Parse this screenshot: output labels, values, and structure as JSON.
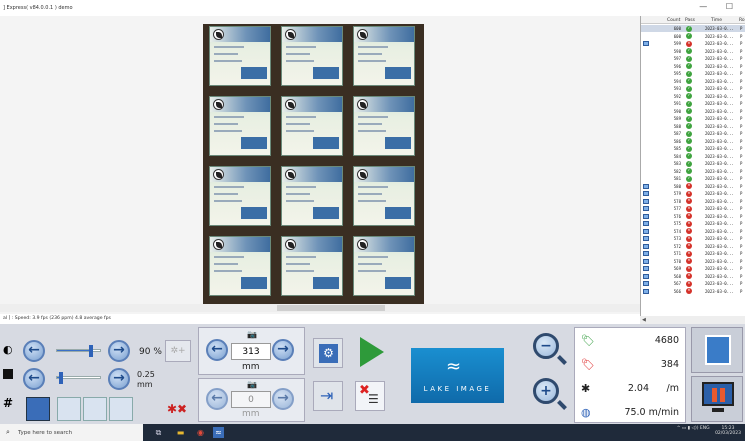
{
  "window": {
    "title": "] Express( v84.0.0.1 ) demo",
    "controls": "— ☐"
  },
  "status": {
    "speed_text": "al ] : Speed: 3.9 fps (236 ppm) 4.8 average fps"
  },
  "table": {
    "headers": {
      "count": "Count",
      "pass": "Pass",
      "time": "Time",
      "more": "Ro"
    },
    "time_text": "2023-03-0...",
    "more_text": "P",
    "rows": [
      {
        "count": "600",
        "pass": true,
        "icon": false,
        "selected": true
      },
      {
        "count": "600",
        "pass": true,
        "icon": false
      },
      {
        "count": "599",
        "pass": false,
        "icon": true
      },
      {
        "count": "598",
        "pass": true,
        "icon": false
      },
      {
        "count": "597",
        "pass": true,
        "icon": false
      },
      {
        "count": "596",
        "pass": true,
        "icon": false
      },
      {
        "count": "595",
        "pass": true,
        "icon": false
      },
      {
        "count": "594",
        "pass": true,
        "icon": false
      },
      {
        "count": "593",
        "pass": true,
        "icon": false
      },
      {
        "count": "592",
        "pass": true,
        "icon": false
      },
      {
        "count": "591",
        "pass": true,
        "icon": false
      },
      {
        "count": "590",
        "pass": true,
        "icon": false
      },
      {
        "count": "589",
        "pass": true,
        "icon": false
      },
      {
        "count": "588",
        "pass": true,
        "icon": false
      },
      {
        "count": "587",
        "pass": true,
        "icon": false
      },
      {
        "count": "586",
        "pass": true,
        "icon": false
      },
      {
        "count": "585",
        "pass": true,
        "icon": false
      },
      {
        "count": "584",
        "pass": true,
        "icon": false
      },
      {
        "count": "583",
        "pass": true,
        "icon": false
      },
      {
        "count": "582",
        "pass": true,
        "icon": false
      },
      {
        "count": "581",
        "pass": true,
        "icon": false
      },
      {
        "count": "580",
        "pass": false,
        "icon": true
      },
      {
        "count": "579",
        "pass": false,
        "icon": true
      },
      {
        "count": "578",
        "pass": false,
        "icon": true
      },
      {
        "count": "577",
        "pass": false,
        "icon": true
      },
      {
        "count": "576",
        "pass": false,
        "icon": true
      },
      {
        "count": "575",
        "pass": false,
        "icon": true
      },
      {
        "count": "574",
        "pass": false,
        "icon": true
      },
      {
        "count": "573",
        "pass": false,
        "icon": true
      },
      {
        "count": "572",
        "pass": false,
        "icon": true
      },
      {
        "count": "571",
        "pass": false,
        "icon": true
      },
      {
        "count": "570",
        "pass": false,
        "icon": true
      },
      {
        "count": "569",
        "pass": false,
        "icon": true
      },
      {
        "count": "568",
        "pass": false,
        "icon": true
      },
      {
        "count": "567",
        "pass": false,
        "icon": true
      },
      {
        "count": "566",
        "pass": false,
        "icon": true
      }
    ],
    "scroll_arrow": "◀"
  },
  "controls": {
    "brightness_value": "90 %",
    "brightness_level": 0.75,
    "contrast_value": "0.25",
    "contrast_unit": "mm",
    "contrast_level": 0.08,
    "offset_value": "313",
    "offset_unit": "mm",
    "offset2_value": "0",
    "offset2_unit": "mm"
  },
  "logo": {
    "waves": "≈",
    "text": "LAKE IMAGE"
  },
  "stats": {
    "total": "4680",
    "rejects": "384",
    "rate": "2.04",
    "rate_unit": "/m",
    "speed": "75.0 m/min"
  },
  "taskbar": {
    "search_placeholder": "Type here to search",
    "lang": "ENG",
    "time": "15:23",
    "date": "02/03/2023"
  },
  "colors": {
    "accent": "#3a6db8",
    "pass": "#3fa33f",
    "fail": "#d4322a",
    "panel": "#d7dae2",
    "logo": "#1a8fd0"
  }
}
